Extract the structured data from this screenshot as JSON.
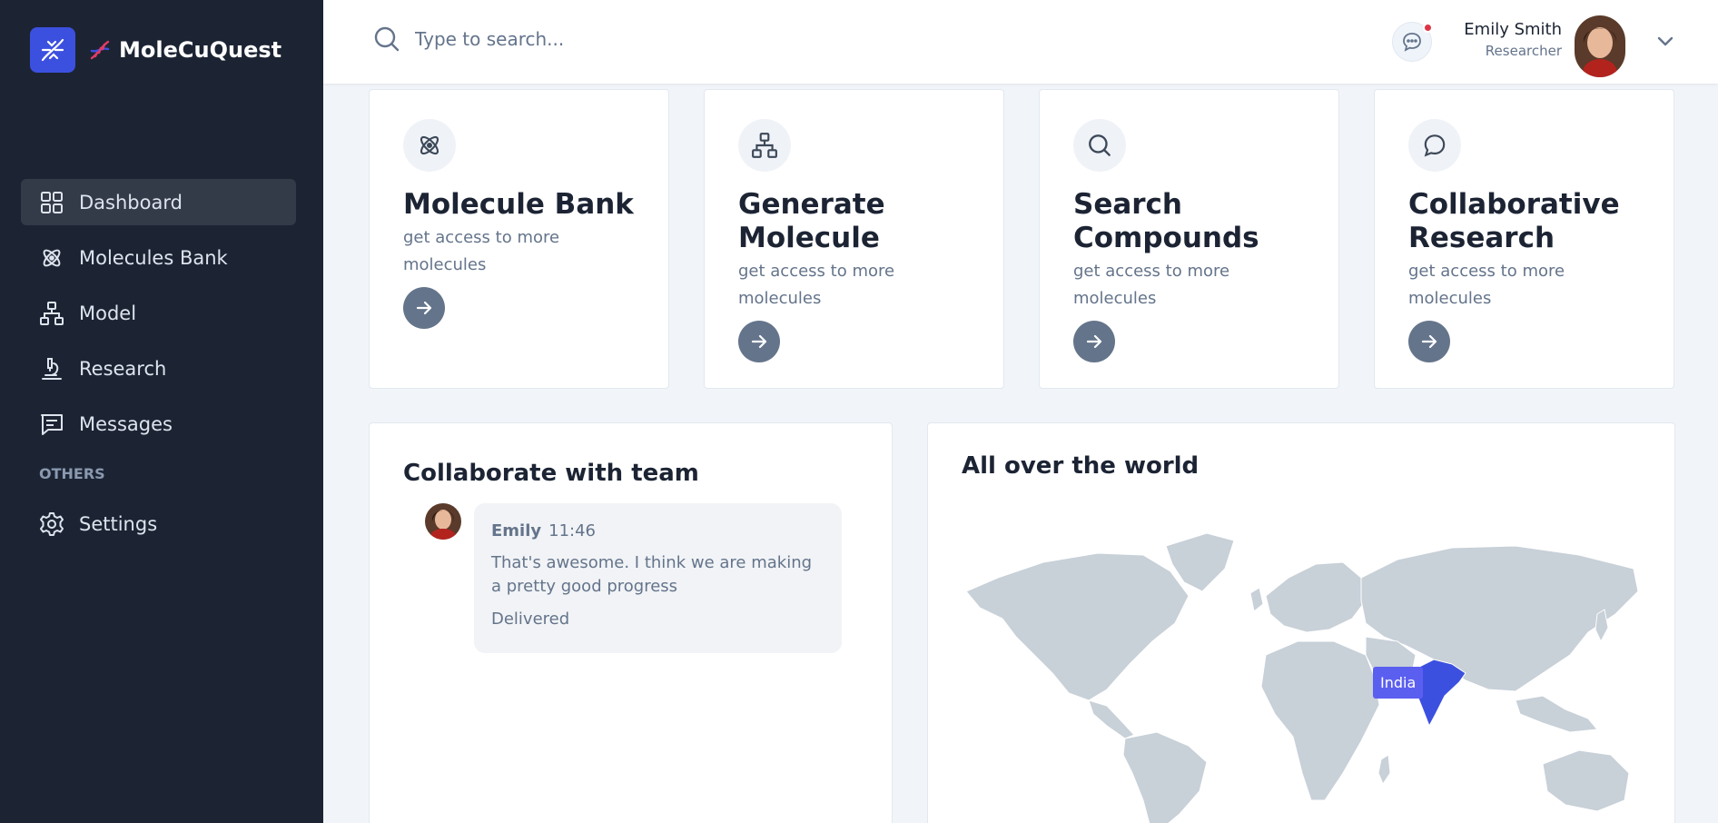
{
  "app": {
    "name": "MoleCuQuest"
  },
  "sidebar": {
    "items": [
      {
        "label": "Dashboard",
        "icon": "grid-icon",
        "active": true
      },
      {
        "label": "Molecules Bank",
        "icon": "atom-icon"
      },
      {
        "label": "Model",
        "icon": "hierarchy-icon"
      },
      {
        "label": "Research",
        "icon": "microscope-icon"
      },
      {
        "label": "Messages",
        "icon": "message-square-icon"
      }
    ],
    "others_label": "OTHERS",
    "settings_label": "Settings"
  },
  "header": {
    "search_placeholder": "Type to search...",
    "user_name": "Emily Smith",
    "user_role": "Researcher"
  },
  "features": [
    {
      "title": "Molecule Bank",
      "desc": "get access to more molecules",
      "icon": "atom-icon"
    },
    {
      "title": "Generate Molecule",
      "desc": "get access to more molecules",
      "icon": "hierarchy-icon"
    },
    {
      "title": "Search Compounds",
      "desc": "get access to more molecules",
      "icon": "search-icon"
    },
    {
      "title": "Collaborative Research",
      "desc": "get access to more molecules",
      "icon": "chat-bubble-icon"
    }
  ],
  "collab": {
    "title": "Collaborate with team",
    "message": {
      "author": "Emily",
      "time": "11:46",
      "text": "That's awesome. I think we are making a pretty good progress",
      "status": "Delivered"
    }
  },
  "world": {
    "title": "All over the world",
    "highlighted_country": "India",
    "colors": {
      "land": "#c8d0d8",
      "highlight": "#3c50e0",
      "tooltip": "#5b5ff0"
    }
  },
  "colors": {
    "sidebar_bg": "#1c2434",
    "accent": "#3c50e0",
    "page_bg": "#f1f5f9"
  }
}
